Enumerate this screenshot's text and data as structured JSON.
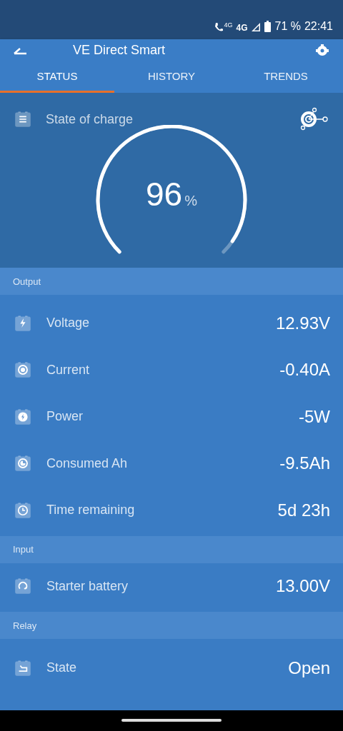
{
  "status_bar": {
    "call_network": "4G",
    "network": "4G",
    "battery": "71 %",
    "time": "22:41"
  },
  "app_bar": {
    "title": "VE Direct Smart"
  },
  "tabs": [
    {
      "label": "STATUS",
      "selected": true
    },
    {
      "label": "HISTORY",
      "selected": false
    },
    {
      "label": "TRENDS",
      "selected": false
    }
  ],
  "state_of_charge": {
    "label": "State of charge",
    "value": "96",
    "unit": "%"
  },
  "sections": [
    {
      "title": "Output",
      "rows": [
        {
          "label": "Voltage",
          "value": "12.93V"
        },
        {
          "label": "Current",
          "value": "-0.40A"
        },
        {
          "label": "Power",
          "value": "-5W"
        },
        {
          "label": "Consumed Ah",
          "value": "-9.5Ah"
        },
        {
          "label": "Time remaining",
          "value": "5d 23h"
        }
      ]
    },
    {
      "title": "Input",
      "rows": [
        {
          "label": "Starter battery",
          "value": "13.00V"
        }
      ]
    },
    {
      "title": "Relay",
      "rows": [
        {
          "label": "State",
          "value": "Open"
        }
      ]
    }
  ]
}
